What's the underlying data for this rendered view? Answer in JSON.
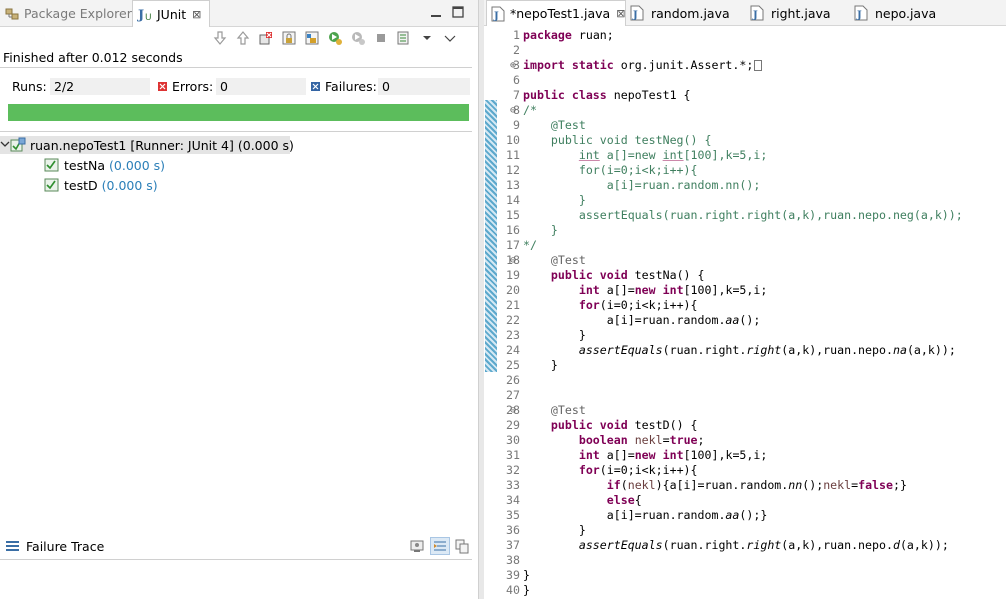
{
  "left_panel": {
    "tabs": [
      {
        "label": "Package Explorer",
        "icon": "package-explorer-icon",
        "active": false
      },
      {
        "label": "JUnit",
        "icon": "junit-icon",
        "active": true
      }
    ],
    "close_glyph": "⊠",
    "status": "Finished after 0.012 seconds",
    "counters": {
      "runs_label": "Runs:",
      "runs_value": "2/2",
      "errors_label": "Errors:",
      "errors_value": "0",
      "failures_label": "Failures:",
      "failures_value": "0"
    },
    "progress": {
      "fraction": 1.0,
      "color": "#5cbd5c"
    },
    "tree": {
      "root": {
        "label": "ruan.nepoTest1 [Runner: JUnit 4]",
        "time": "(0.000 s)"
      },
      "children": [
        {
          "label": "testNa",
          "time": "(0.000 s)"
        },
        {
          "label": "testD",
          "time": "(0.000 s)"
        }
      ]
    },
    "failure_trace_label": "Failure Trace"
  },
  "editor": {
    "tabs": [
      {
        "label": "*nepoTest1.java",
        "close": "⊠",
        "active": true
      },
      {
        "label": "random.java",
        "active": false
      },
      {
        "label": "right.java",
        "active": false
      },
      {
        "label": "nepo.java",
        "active": false
      }
    ],
    "line_numbers": [
      "1",
      "2",
      "3",
      "6",
      "7",
      "8",
      "9",
      "10",
      "11",
      "12",
      "13",
      "14",
      "15",
      "16",
      "17",
      "18",
      "19",
      "20",
      "21",
      "22",
      "23",
      "24",
      "25",
      "26",
      "27",
      "28",
      "29",
      "30",
      "31",
      "32",
      "33",
      "34",
      "35",
      "36",
      "37",
      "38",
      "39",
      "40"
    ],
    "colors": {
      "keyword": "#7f0055",
      "comment": "#3f7f5f",
      "annotation": "#646464",
      "line_number": "#787878"
    }
  }
}
